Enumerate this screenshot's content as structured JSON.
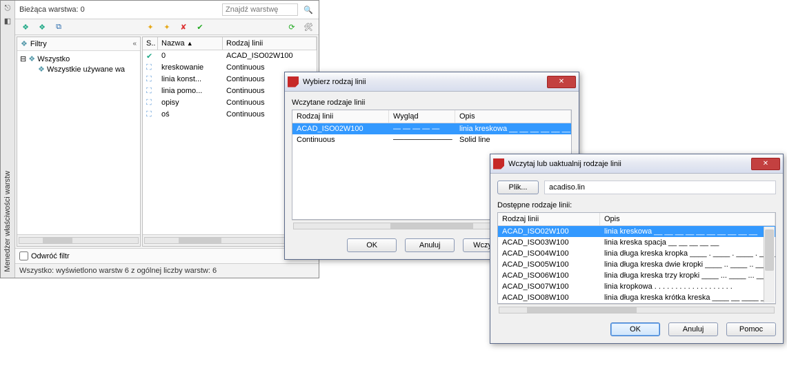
{
  "sidebar": {
    "label": "Menedżer właściwości warstw"
  },
  "header": {
    "title": "Bieżąca warstwa: 0",
    "search_placeholder": "Znajdź warstwę"
  },
  "filter_panel": {
    "title": "Filtry",
    "tree": [
      {
        "label": "Wszystko",
        "depth": 0
      },
      {
        "label": "Wszystkie używane wa",
        "depth": 1
      }
    ]
  },
  "layer_table": {
    "columns": {
      "status": "S..",
      "name": "Nazwa",
      "linetype": "Rodzaj linii"
    },
    "rows": [
      {
        "name": "0",
        "linetype": "ACAD_ISO02W100"
      },
      {
        "name": "kreskowanie",
        "linetype": "Continuous"
      },
      {
        "name": "linia konst...",
        "linetype": "Continuous"
      },
      {
        "name": "linia pomo...",
        "linetype": "Continuous"
      },
      {
        "name": "opisy",
        "linetype": "Continuous"
      },
      {
        "name": "oś",
        "linetype": "Continuous"
      }
    ]
  },
  "footer": {
    "invert": "Odwróć filtr"
  },
  "status": "Wszystko: wyświetlono warstw 6 z ogólnej liczby warstw: 6",
  "dialog1": {
    "title": "Wybierz rodzaj linii",
    "section": "Wczytane rodzaje linii",
    "columns": {
      "lt": "Rodzaj linii",
      "look": "Wygląd",
      "desc": "Opis"
    },
    "rows": [
      {
        "lt": "ACAD_ISO02W100",
        "look": "—  —  —  —  —",
        "desc": "linia kreskowa __ __ __ __ __ __",
        "sel": true
      },
      {
        "lt": "Continuous",
        "look": "───────────",
        "desc": "Solid line",
        "sel": false
      }
    ],
    "buttons": {
      "ok": "OK",
      "cancel": "Anuluj",
      "load": "Wczytaj..."
    }
  },
  "dialog2": {
    "title": "Wczytaj lub uaktualnij rodzaje linii",
    "file_btn": "Plik...",
    "file_name": "acadiso.lin",
    "section": "Dostępne rodzaje linii:",
    "columns": {
      "lt": "Rodzaj linii",
      "desc": "Opis"
    },
    "rows": [
      {
        "lt": "ACAD_ISO02W100",
        "desc": "linia kreskowa __ __ __ __ __ __ __ __ __ __",
        "sel": true
      },
      {
        "lt": "ACAD_ISO03W100",
        "desc": "linia kreska spacja __    __    __    __    __"
      },
      {
        "lt": "ACAD_ISO04W100",
        "desc": "linia długa kreska kropka ____ . ____ . ____ . ____"
      },
      {
        "lt": "ACAD_ISO05W100",
        "desc": "linia długa kreska dwie kropki ____ .. ____ .. ____"
      },
      {
        "lt": "ACAD_ISO06W100",
        "desc": "linia długa kreska trzy kropki ____ ... ____ ... __"
      },
      {
        "lt": "ACAD_ISO07W100",
        "desc": "linia kropkowa . . . . . . . . . . . . . . . . . . ."
      },
      {
        "lt": "ACAD_ISO08W100",
        "desc": "linia długa kreska krótka kreska ____ __ ____ _"
      }
    ],
    "buttons": {
      "ok": "OK",
      "cancel": "Anuluj",
      "help": "Pomoc"
    }
  }
}
